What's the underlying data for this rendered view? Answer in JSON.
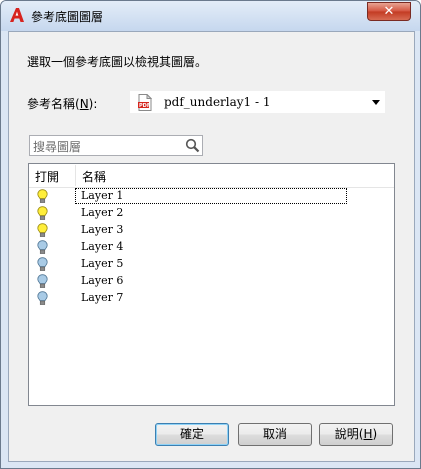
{
  "window": {
    "title": "參考底圖圖層"
  },
  "instruction": "選取一個參考底圖以檢視其圖層。",
  "reference": {
    "label_pre": "參考名稱(",
    "label_key": "N",
    "label_post": "):",
    "value": "pdf_underlay1 - 1"
  },
  "search": {
    "placeholder": "搜尋圖層"
  },
  "list": {
    "headers": {
      "on": "打開",
      "name": "名稱"
    },
    "rows": [
      {
        "name": "Layer 1",
        "on": true
      },
      {
        "name": "Layer 2",
        "on": true
      },
      {
        "name": "Layer 3",
        "on": true
      },
      {
        "name": "Layer 4",
        "on": false
      },
      {
        "name": "Layer 5",
        "on": false
      },
      {
        "name": "Layer 6",
        "on": false
      },
      {
        "name": "Layer 7",
        "on": false
      }
    ]
  },
  "buttons": {
    "ok": "確定",
    "cancel": "取消",
    "help_pre": "說明(",
    "help_key": "H",
    "help_post": ")"
  },
  "colors": {
    "bulb_on": "#ffee3a",
    "bulb_off": "#a9cbe6",
    "close": "#c94a32"
  },
  "icons": {
    "app": "autocad-a-icon",
    "close": "close-icon",
    "file": "pdf-file-icon",
    "search": "magnifier-icon",
    "bulb": "lightbulb-icon",
    "dropdown": "chevron-down-icon"
  }
}
